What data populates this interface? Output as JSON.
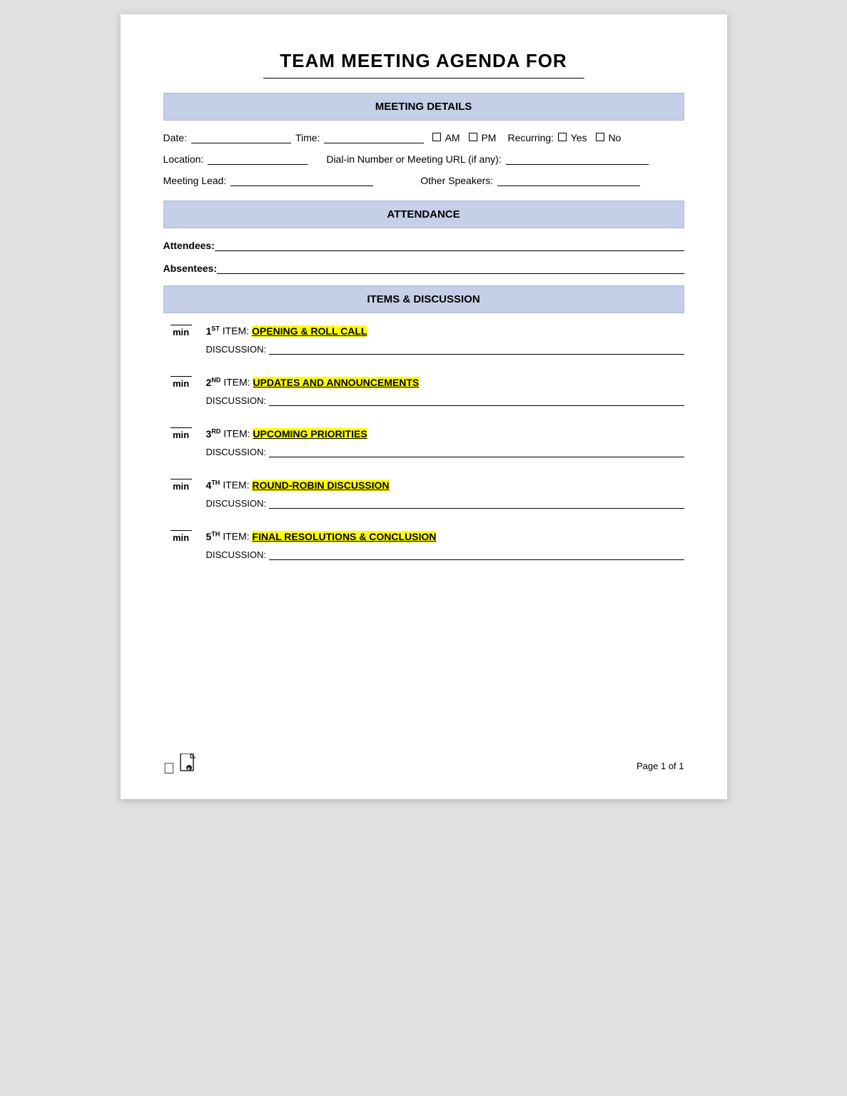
{
  "title": "TEAM MEETING AGENDA FOR",
  "sections": {
    "meeting_details": {
      "header": "MEETING DETAILS",
      "fields": {
        "date_label": "Date:",
        "time_label": "Time:",
        "am_label": "AM",
        "pm_label": "PM",
        "recurring_label": "Recurring:",
        "yes_label": "Yes",
        "no_label": "No",
        "location_label": "Location:",
        "dialin_label": "Dial-in Number or Meeting URL (if any):",
        "meeting_lead_label": "Meeting Lead:",
        "other_speakers_label": "Other Speakers:"
      }
    },
    "attendance": {
      "header": "ATTENDANCE",
      "attendees_label": "Attendees:",
      "absentees_label": "Absentees"
    },
    "items_discussion": {
      "header": "ITEMS & DISCUSSION",
      "items": [
        {
          "number": "1",
          "ordinal": "ST",
          "title_prefix": "ITEM: ",
          "title_highlight": "OPENING & ROLL CALL",
          "discussion_label": "DISCUSSION:"
        },
        {
          "number": "2",
          "ordinal": "ND",
          "title_prefix": "ITEM: ",
          "title_highlight": "UPDATES AND ANNOUNCEMENTS",
          "discussion_label": "DISCUSSION:"
        },
        {
          "number": "3",
          "ordinal": "RD",
          "title_prefix": "ITEM: ",
          "title_highlight": "UPCOMING PRIORITIES",
          "discussion_label": "DISCUSSION:"
        },
        {
          "number": "4",
          "ordinal": "TH",
          "title_prefix": "ITEM: ",
          "title_highlight": "ROUND-ROBIN DISCUSSION",
          "discussion_label": "DISCUSSION:"
        },
        {
          "number": "5",
          "ordinal": "TH",
          "title_prefix": "ITEM: ",
          "title_highlight": "FINAL RESOLUTIONS & CONCLUSION",
          "discussion_label": "DISCUSSION:"
        }
      ]
    }
  },
  "footer": {
    "page_label": "Page 1 of 1"
  }
}
